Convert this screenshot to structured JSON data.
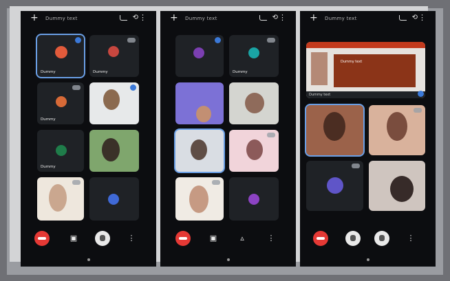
{
  "screens": [
    {
      "title": "Dummy text",
      "tiles": [
        {
          "name": "Dummy",
          "bg": "#1f2226",
          "avatar": "#e25b3b",
          "active": true
        },
        {
          "name": "Dummy",
          "bg": "#1f2226",
          "avatar": "#c7473f"
        },
        {
          "name": "Dummy",
          "bg": "#1f2226",
          "avatar": "#d76a37"
        },
        {
          "name": "",
          "bg": "#e7e9ea",
          "avatar": "#8b6a4f"
        },
        {
          "name": "Dummy",
          "bg": "#1f2226",
          "avatar": "#1f7d4a"
        },
        {
          "name": "",
          "bg": "#7fa66d",
          "avatar": "#3a3128"
        },
        {
          "name": "",
          "bg": "#eee7dd",
          "avatar": "#caa78f"
        },
        {
          "name": "",
          "bg": "#1f2226",
          "avatar": "#3f69d6"
        }
      ]
    },
    {
      "title": "Dummy text",
      "tiles": [
        {
          "name": "",
          "bg": "#1f2226",
          "avatar": "#7b3fb1"
        },
        {
          "name": "Dummy",
          "bg": "#1f2226",
          "avatar": "#1aa4a4"
        },
        {
          "name": "",
          "bg": "#7c71d6",
          "avatar": "#c28f73"
        },
        {
          "name": "",
          "bg": "#d4d5d0",
          "avatar": "#8f6b5b"
        },
        {
          "name": "",
          "bg": "#d9dde3",
          "avatar": "#5f4d45",
          "active": true
        },
        {
          "name": "",
          "bg": "#f1d4da",
          "avatar": "#8c5a5a"
        },
        {
          "name": "",
          "bg": "#f0ebe4",
          "avatar": "#c69a83"
        },
        {
          "name": "",
          "bg": "#1f2226",
          "avatar": "#8c43c3"
        }
      ]
    },
    {
      "title": "Dummy text",
      "presentation": {
        "banner": "Dummy text",
        "caption": "Dummy text"
      },
      "tiles": [
        {
          "name": "",
          "bg": "#9b624a",
          "avatar": "#4b2d22",
          "active": true
        },
        {
          "name": "",
          "bg": "#d9b29c",
          "avatar": "#7a4d3e"
        },
        {
          "name": "",
          "bg": "#1f2226",
          "avatar": "#5f55c8"
        },
        {
          "name": "",
          "bg": "#cfc5bf",
          "avatar": "#372b29"
        }
      ]
    }
  ],
  "controls": {
    "end_call": "end-call",
    "camera": "camera",
    "mic": "mic",
    "more": "more"
  }
}
